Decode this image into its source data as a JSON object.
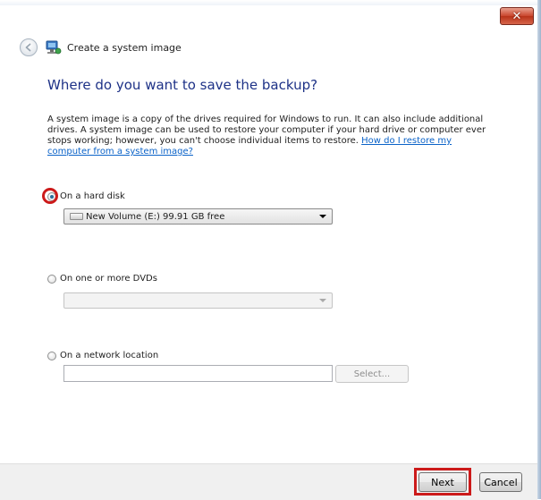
{
  "window": {
    "title": "Create a system image",
    "close_label": "✕"
  },
  "page": {
    "heading": "Where do you want to save the backup?",
    "description": "A system image is a copy of the drives required for Windows to run. It can also include additional drives. A system image can be used to restore your computer if your hard drive or computer ever stops working; however, you can't choose individual items to restore. ",
    "help_link": "How do I restore my computer from a system image?"
  },
  "options": {
    "hard_disk": {
      "label": "On a hard disk",
      "selected": true,
      "dropdown_value": "New Volume (E:)  99.91 GB free"
    },
    "dvds": {
      "label": "On one or more DVDs",
      "selected": false,
      "dropdown_value": ""
    },
    "network": {
      "label": "On a network location",
      "selected": false,
      "input_value": "",
      "select_button": "Select..."
    }
  },
  "footer": {
    "next": "Next",
    "cancel": "Cancel"
  },
  "annotations": {
    "highlight_color": "#cc1a1a"
  }
}
